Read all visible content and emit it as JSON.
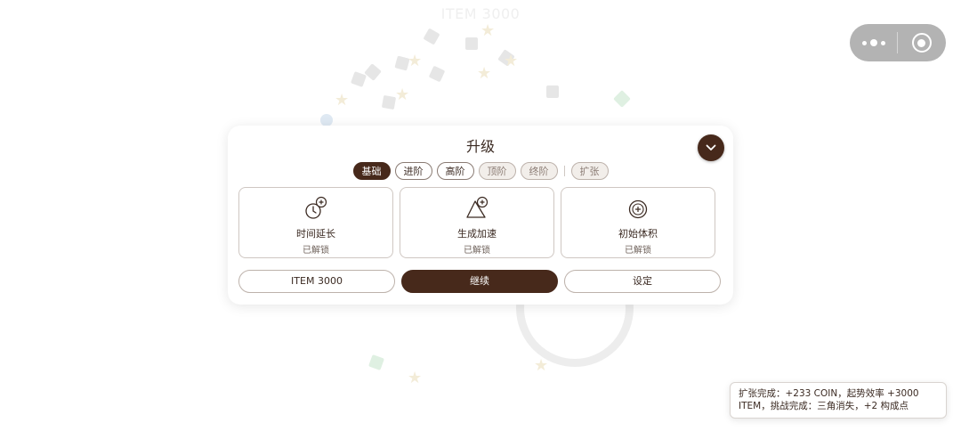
{
  "background": {
    "title": "ITEM 3000"
  },
  "capsule": {
    "more_icon": "more-dots-icon",
    "close_icon": "target-circle-icon"
  },
  "panel": {
    "title": "升级",
    "collapse_icon": "chevron-down-icon",
    "tabs": [
      {
        "label": "基础",
        "state": "active"
      },
      {
        "label": "进阶",
        "state": "normal"
      },
      {
        "label": "高阶",
        "state": "normal"
      },
      {
        "label": "顶阶",
        "state": "locked"
      },
      {
        "label": "终阶",
        "state": "locked"
      },
      {
        "label": "扩张",
        "state": "locked"
      }
    ],
    "cards": [
      {
        "name": "时间延长",
        "status": "已解锁",
        "icon": "clock-plus-icon"
      },
      {
        "name": "生成加速",
        "status": "已解锁",
        "icon": "triangle-plus-icon"
      },
      {
        "name": "初始体积",
        "status": "已解锁",
        "icon": "coin-plus-icon"
      }
    ],
    "actions": {
      "item": "ITEM 3000",
      "continue": "继续",
      "settings": "设定"
    }
  },
  "toast": {
    "line1": "扩张完成：+233 COIN，起势效率 +3000",
    "line2": "ITEM，挑战完成：三角消失，+2 构成点"
  },
  "colors": {
    "accent": "#47291b",
    "text": "#3b2a22",
    "capsule": "#b3b3b3"
  }
}
